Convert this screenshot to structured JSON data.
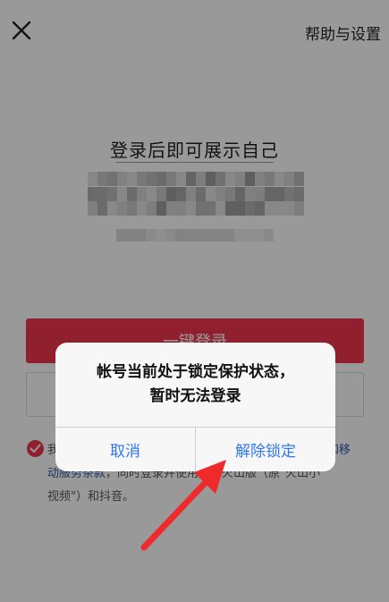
{
  "topbar": {
    "close_icon": "close-icon",
    "help_label": "帮助与设置"
  },
  "title": "登录后即可展示自己",
  "login_button": "一键登录",
  "agreement": {
    "prefix": "我",
    "link_end": "和移",
    "link_line2": "动服务条款",
    "rest_line2": "，同时登录并使用抖音火山版（原\"火山小",
    "line3": "视频\"）和抖音。"
  },
  "dialog": {
    "message_line1": "帐号当前处于锁定保护状态，",
    "message_line2": "暂时无法登录",
    "cancel_label": "取消",
    "unlock_label": "解除锁定"
  },
  "colors": {
    "brand_red": "#f0364e",
    "ios_blue": "#2f78f0",
    "arrow_red": "#ee2a2a"
  }
}
